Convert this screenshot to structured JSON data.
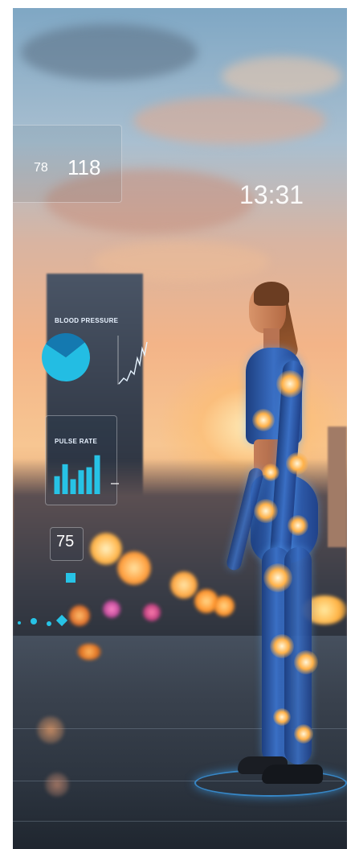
{
  "hud": {
    "stat_small": "78",
    "stat_large": "118",
    "time": "13:31",
    "blood_pressure_label": "BLOOD PRESSURE",
    "pulse_rate_label": "PULSE RATE",
    "pulse_value": "75"
  },
  "colors": {
    "accent": "#27c3e6",
    "accent_dark": "#1b86b8",
    "glow": "#ffb24a",
    "suit": "#2f63b8"
  },
  "chart_data": [
    {
      "type": "pie",
      "title": "BLOOD PRESSURE",
      "values": [
        70,
        30
      ],
      "colors": [
        "#23bde3",
        "#1479b0"
      ]
    },
    {
      "type": "bar",
      "title": "PULSE RATE",
      "values": [
        6,
        10,
        5,
        8,
        9,
        13
      ],
      "ylim": [
        0,
        14
      ]
    }
  ]
}
